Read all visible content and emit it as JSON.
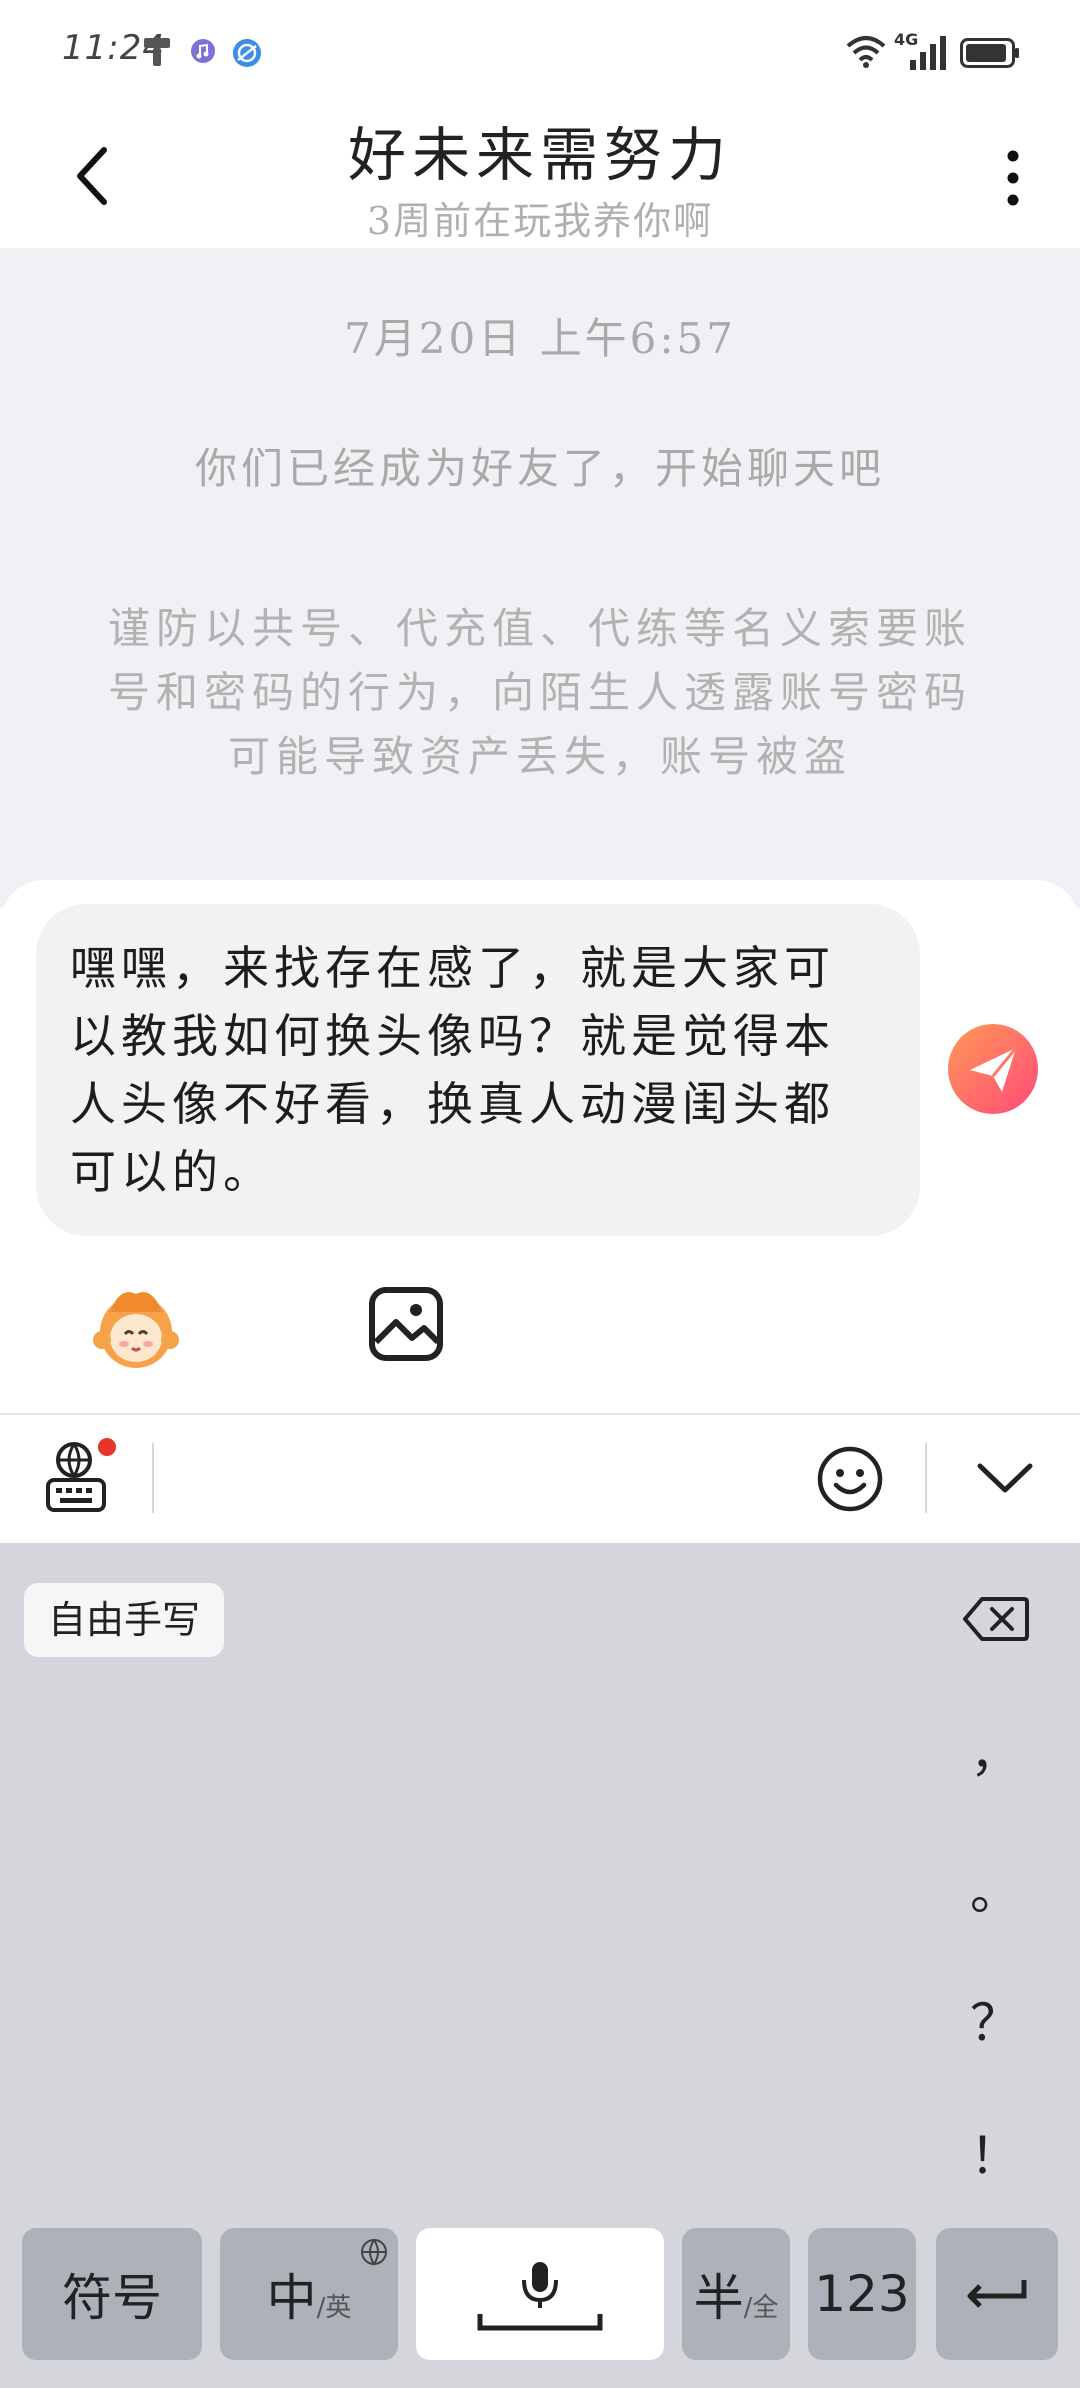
{
  "status_bar": {
    "time": "11:24",
    "network": "4G"
  },
  "header": {
    "title": "好未来需努力",
    "subtitle": "3周前在玩我养你啊"
  },
  "chat": {
    "timestamp": "7月20日 上午6:57",
    "friend_note": "你们已经成为好友了，开始聊天吧",
    "warning_lines": [
      "谨防以共号、代充值、代练等名义索要账",
      "号和密码的行为，向陌生人透露账号密码",
      "可能导致资产丢失，账号被盗"
    ]
  },
  "composer": {
    "message_lines": [
      "嘿嘿，来找存在感了，就是大家可",
      "以教我如何换头像吗？就是觉得本",
      "人头像不好看，换真人动漫闺头都",
      "可以的。"
    ]
  },
  "keyboard": {
    "handwriting_label": "自由手写",
    "punctuation": [
      "，",
      "。",
      "？",
      "！"
    ],
    "keys": {
      "symbols": "符号",
      "chinese_main": "中",
      "chinese_sub": "/英",
      "half_main": "半",
      "half_sub": "/全",
      "numbers": "123"
    }
  },
  "colors": {
    "chat_bg": "#eff1f4",
    "bubble_bg": "#f2f2f2",
    "send_gradient_start": "#ff9a55",
    "send_gradient_end": "#ff4a7a",
    "keyboard_bg": "#d4d6dc",
    "key_bg": "#adb1ba",
    "notification_dot": "#e8352b"
  },
  "icons": {
    "status": [
      "brush-icon",
      "music-icon",
      "browser-icon",
      "wifi-icon",
      "signal-icon",
      "battery-icon"
    ],
    "header": [
      "back-arrow-icon",
      "more-vertical-icon"
    ],
    "composer": [
      "send-paper-plane-icon",
      "mascot-avatar-icon",
      "image-icon"
    ],
    "toolbar": [
      "keyboard-globe-icon",
      "emoji-icon",
      "chevron-down-icon"
    ],
    "keyboard": [
      "backspace-icon",
      "globe-small-icon",
      "microphone-icon",
      "enter-icon"
    ]
  }
}
